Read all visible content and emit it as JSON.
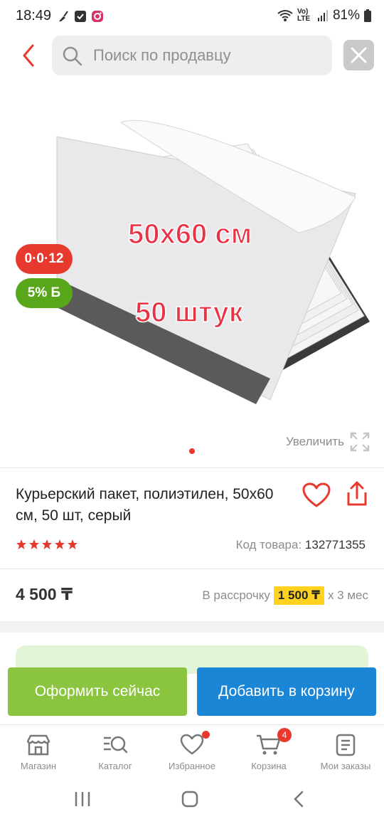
{
  "status_bar": {
    "time": "18:49",
    "battery": "81%",
    "network": "Vo) LTE"
  },
  "search": {
    "placeholder": "Поиск по продавцу",
    "value": ""
  },
  "gallery": {
    "image_text_size": "50x60 см",
    "image_text_count": "50 штук",
    "badge_installment": "0·0·12",
    "badge_bonus": "5% Б",
    "zoom_label": "Увеличить"
  },
  "product": {
    "title": "Курьерский пакет, полиэтилен, 50х60 см, 50 шт, серый",
    "rating": 5,
    "code_label": "Код товара:",
    "code": "132771355",
    "price": "4 500 ₸",
    "installment_label": "В рассрочку",
    "installment_amount": "1 500 ₸",
    "installment_term": "х 3 мес"
  },
  "actions": {
    "buy_now": "Оформить сейчас",
    "add_to_cart": "Добавить в корзину"
  },
  "bottom_nav": [
    {
      "label": "Магазин",
      "icon": "store-icon"
    },
    {
      "label": "Каталог",
      "icon": "catalog-search-icon"
    },
    {
      "label": "Избранное",
      "icon": "heart-icon"
    },
    {
      "label": "Корзина",
      "icon": "cart-icon",
      "badge": "4"
    },
    {
      "label": "Мои заказы",
      "icon": "orders-icon"
    }
  ],
  "colors": {
    "accent_red": "#e8392f",
    "buy_green": "#8bc43f",
    "cart_blue": "#1b86d6",
    "installment_yellow": "#ffd21f",
    "bonus_green": "#58a619"
  }
}
